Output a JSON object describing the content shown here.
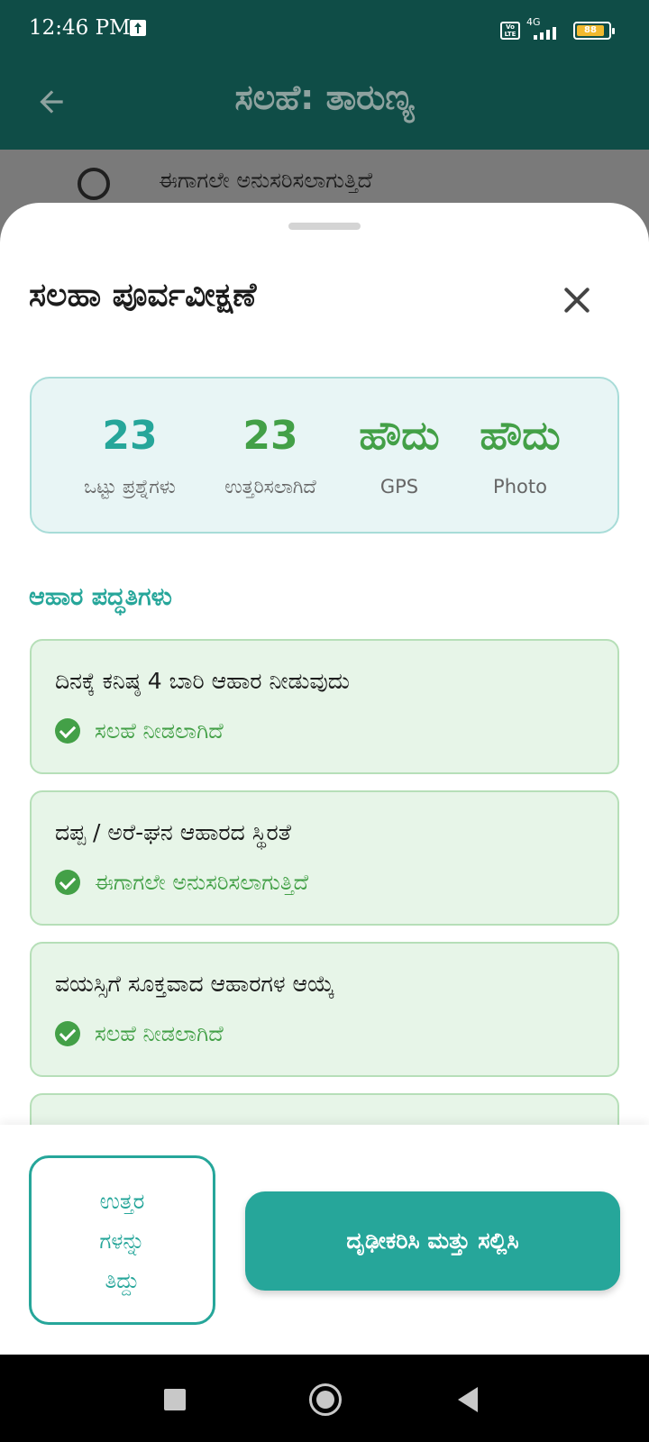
{
  "status_bar": {
    "time": "12:46 PM",
    "volte": "Vo LTE",
    "network": "4G",
    "battery": "88",
    "battery_level": 0.88
  },
  "app_bar": {
    "title": "ಸಲಹೆ: ತಾರುಣ್ಯ",
    "back_icon": "arrow-left-icon"
  },
  "behind_content": {
    "option_text": "ಈಗಾಗಲೇ ಅನುಸರಿಸಲಾಗುತ್ತಿದೆ"
  },
  "sheet": {
    "title": "ಸಲಹಾ ಪೂರ್ವವೀಕ್ಷಣೆ",
    "close_icon": "close-icon",
    "summary": {
      "total_questions": {
        "value": "23",
        "label": "ಒಟ್ಟು ಪ್ರಶ್ನೆಗಳು"
      },
      "answered": {
        "value": "23",
        "label": "ಉತ್ತರಿಸಲಾಗಿದೆ"
      },
      "gps": {
        "value": "ಹೌದು",
        "label": "GPS"
      },
      "photo": {
        "value": "ಹೌದು",
        "label": "Photo"
      }
    },
    "section_title": "ಆಹಾರ ಪದ್ಧತಿಗಳು",
    "items": [
      {
        "title": "ದಿನಕ್ಕೆ ಕನಿಷ್ಠ 4 ಬಾರಿ ಆಹಾರ ನೀಡುವುದು",
        "status": "ಸಲಹೆ ನೀಡಲಾಗಿದೆ"
      },
      {
        "title": "ದಪ್ಪ / ಅರೆ-ಘನ ಆಹಾರದ ಸ್ಥಿರತೆ",
        "status": "ಈಗಾಗಲೇ ಅನುಸರಿಸಲಾಗುತ್ತಿದೆ"
      },
      {
        "title": "ವಯಸ್ಸಿಗೆ ಸೂಕ್ತವಾದ ಆಹಾರಗಳ ಆಯ್ಕೆ",
        "status": "ಸಲಹೆ ನೀಡಲಾಗಿದೆ"
      },
      {
        "title": "",
        "status": ""
      }
    ]
  },
  "footer": {
    "edit_label": "ಉತ್ತರ\nಗಳನ್ನು\nತಿದ್ದು",
    "submit_label": "ದೃಢೀಕರಿಸಿ ಮತ್ತು ಸಲ್ಲಿಸಿ"
  },
  "nav_bar": {
    "recent_icon": "square-icon",
    "home_icon": "circle-icon",
    "back_icon": "triangle-back-icon"
  },
  "colors": {
    "primary_dark": "#0f4d47",
    "accent": "#26a69a",
    "success": "#43a047"
  }
}
